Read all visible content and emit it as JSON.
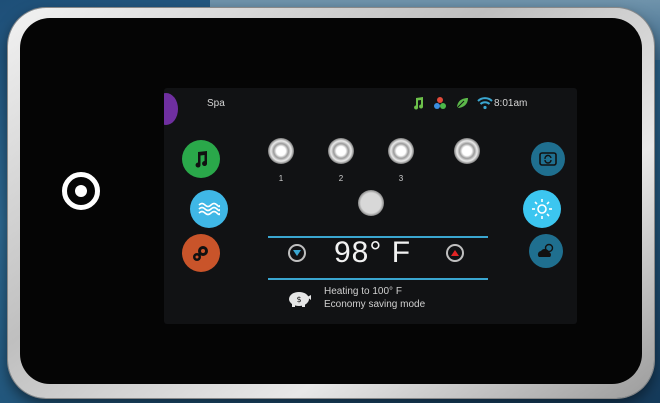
{
  "header": {
    "mode_label": "Spa",
    "time": "8:01am"
  },
  "status_icons": [
    "music-note-icon",
    "cluster-icon",
    "leaf-icon",
    "wifi-icon"
  ],
  "left_buttons": [
    {
      "name": "music-button",
      "icon": "music-note-icon",
      "color": "#2aa84a"
    },
    {
      "name": "water-button",
      "icon": "water-waves-icon",
      "color": "#3fb7e6"
    },
    {
      "name": "settings-button",
      "icon": "gears-icon",
      "color": "#c9542a"
    }
  ],
  "right_buttons": [
    {
      "name": "cycle-button",
      "icon": "cycle-icon",
      "color": "#1f6f8f"
    },
    {
      "name": "light-button",
      "icon": "sun-icon",
      "color": "#3cc6f0"
    },
    {
      "name": "weather-button",
      "icon": "cloud-sun-icon",
      "color": "#1f6f8f"
    }
  ],
  "jets": [
    {
      "label": "1"
    },
    {
      "label": "2"
    },
    {
      "label": "3"
    },
    {
      "label": ""
    }
  ],
  "temperature": {
    "value": "98° F",
    "down_arrow_color": "#3aa6d0",
    "up_arrow_color": "#e32424"
  },
  "messages": {
    "line1": "Heating to 100° F",
    "line2": "Economy saving mode"
  }
}
